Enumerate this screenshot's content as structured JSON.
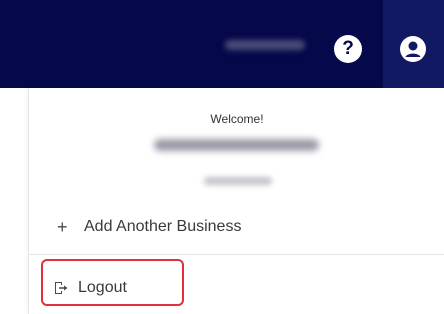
{
  "topbar": {
    "help_label": "?",
    "icons": {
      "help": "help-circle-icon",
      "account": "user-circle-icon"
    },
    "colors": {
      "background": "#05084a",
      "account_button_bg": "#101962"
    }
  },
  "dropdown": {
    "welcome": "Welcome!",
    "add_business": {
      "prefix": "+",
      "label": "Add Another Business"
    },
    "logout": {
      "label": "Logout",
      "icon": "logout-icon"
    },
    "highlight_color": "#e0303a"
  }
}
